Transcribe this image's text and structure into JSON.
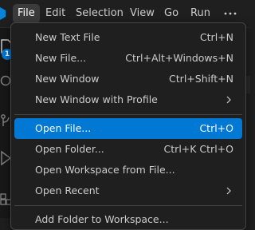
{
  "titlebar": {
    "menus": [
      {
        "label": "File",
        "active": true
      },
      {
        "label": "Edit"
      },
      {
        "label": "Selection"
      },
      {
        "label": "View"
      },
      {
        "label": "Go"
      },
      {
        "label": "Run"
      }
    ],
    "more_icon": "more-horizontal-icon"
  },
  "activity_bar": {
    "badge": "1",
    "icons": [
      "explorer-icon",
      "search-icon",
      "source-control-icon",
      "run-debug-icon",
      "extensions-icon"
    ]
  },
  "file_menu": {
    "items": [
      {
        "label": "New Text File",
        "shortcut": "Ctrl+N"
      },
      {
        "label": "New File...",
        "shortcut": "Ctrl+Alt+Windows+N"
      },
      {
        "label": "New Window",
        "shortcut": "Ctrl+Shift+N"
      },
      {
        "label": "New Window with Profile",
        "submenu": true
      },
      {
        "label": "Open File...",
        "shortcut": "Ctrl+O",
        "selected": true
      },
      {
        "label": "Open Folder...",
        "shortcut": "Ctrl+K Ctrl+O"
      },
      {
        "label": "Open Workspace from File..."
      },
      {
        "label": "Open Recent",
        "submenu": true
      },
      {
        "label": "Add Folder to Workspace..."
      }
    ]
  },
  "colors": {
    "accent": "#0078d4",
    "menu_background": "#1f1f1f",
    "menu_border": "#454545",
    "text": "#cccccc"
  }
}
